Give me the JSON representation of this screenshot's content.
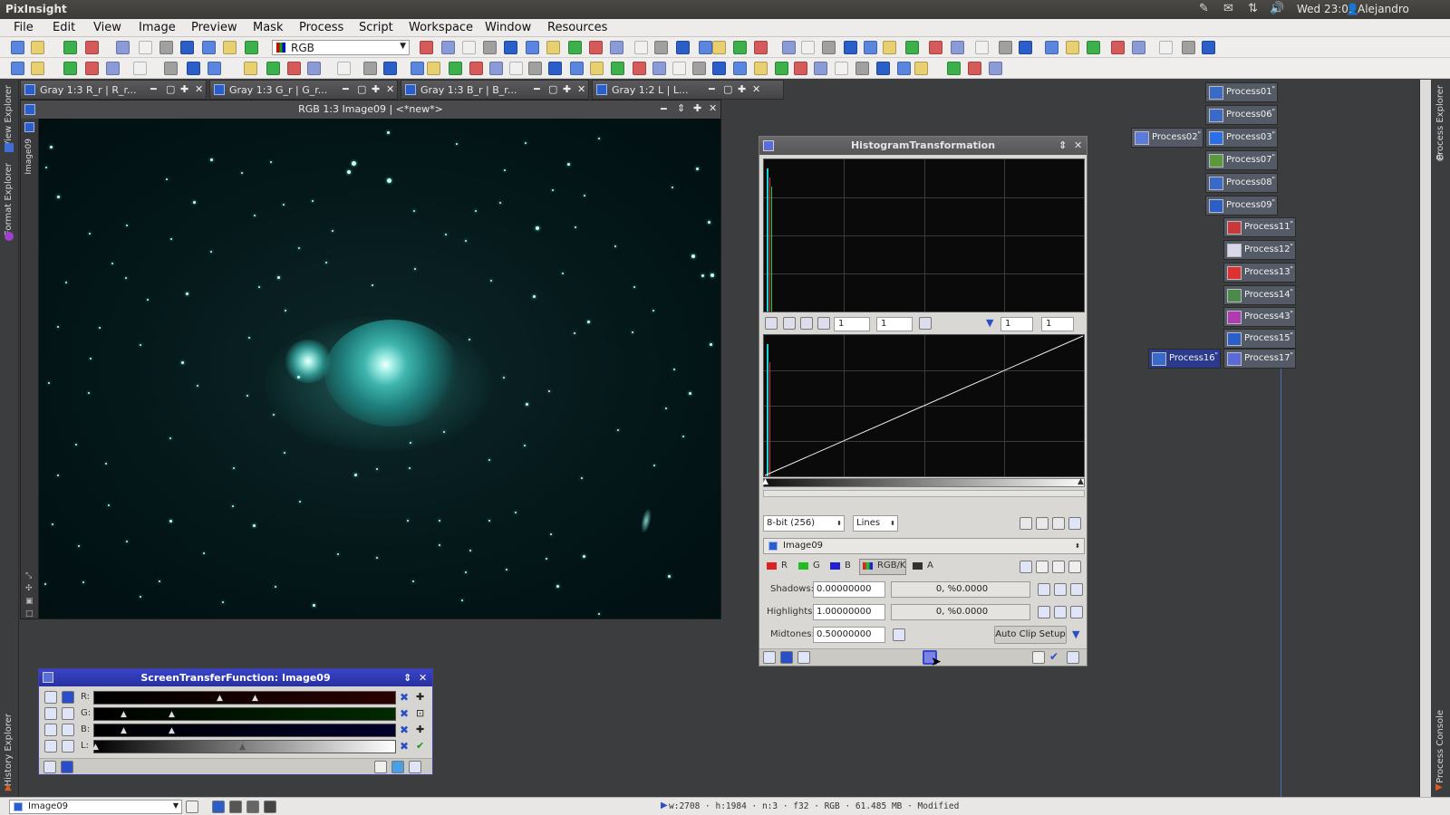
{
  "topbar": {
    "app_name": "PixInsight",
    "clock": "Wed 23:05",
    "user": "Alejandro"
  },
  "menu": [
    "File",
    "Edit",
    "View",
    "Image",
    "Preview",
    "Mask",
    "Process",
    "Script",
    "Workspace",
    "Window",
    "Resources"
  ],
  "toolbar": {
    "channel_select": "RGB"
  },
  "side_tabs": {
    "left": [
      "View Explorer",
      "Format Explorer",
      "History Explorer"
    ],
    "right": [
      "Process Explorer",
      "Process Console"
    ]
  },
  "image_tabs": [
    "Gray 1:3 R_r | R_r...",
    "Gray 1:3 G_r | G_r...",
    "Gray 1:3 B_r | B_r...",
    "Gray 1:2 L | L..."
  ],
  "image_window": {
    "title": "RGB 1:3 Image09 | <*new*>",
    "side_label": "Image09"
  },
  "histogram": {
    "title": "HistogramTransformation",
    "zoom": [
      "1",
      "1"
    ],
    "zoom2": [
      "1",
      "1"
    ],
    "resolution": "8-bit (256)",
    "graph_style": "Lines",
    "view": "Image09",
    "channels": [
      "R",
      "G",
      "B",
      "RGB/K",
      "A"
    ],
    "shadows_label": "Shadows:",
    "shadows_value": "0.00000000",
    "shadows_clip": "0, %0.0000",
    "highlights_label": "Highlights:",
    "highlights_value": "1.00000000",
    "highlights_clip": "0, %0.0000",
    "midtones_label": "Midtones:",
    "midtones_value": "0.50000000",
    "auto_clip": "Auto Clip Setup"
  },
  "stf": {
    "title": "ScreenTransferFunction: Image09",
    "channels": [
      "R:",
      "G:",
      "B:",
      "L:"
    ]
  },
  "process_icons": [
    "Process01",
    "Process06",
    "Process02",
    "Process03",
    "Process07",
    "Process08",
    "Process09",
    "Process11",
    "Process12",
    "Process13",
    "Process14",
    "Process43",
    "Process15",
    "Process16",
    "Process17"
  ],
  "statusbar": {
    "view": "Image09",
    "info": "w:2708 · h:1984 · n:3 · f32 · RGB · 61.485 MB · Modified"
  }
}
